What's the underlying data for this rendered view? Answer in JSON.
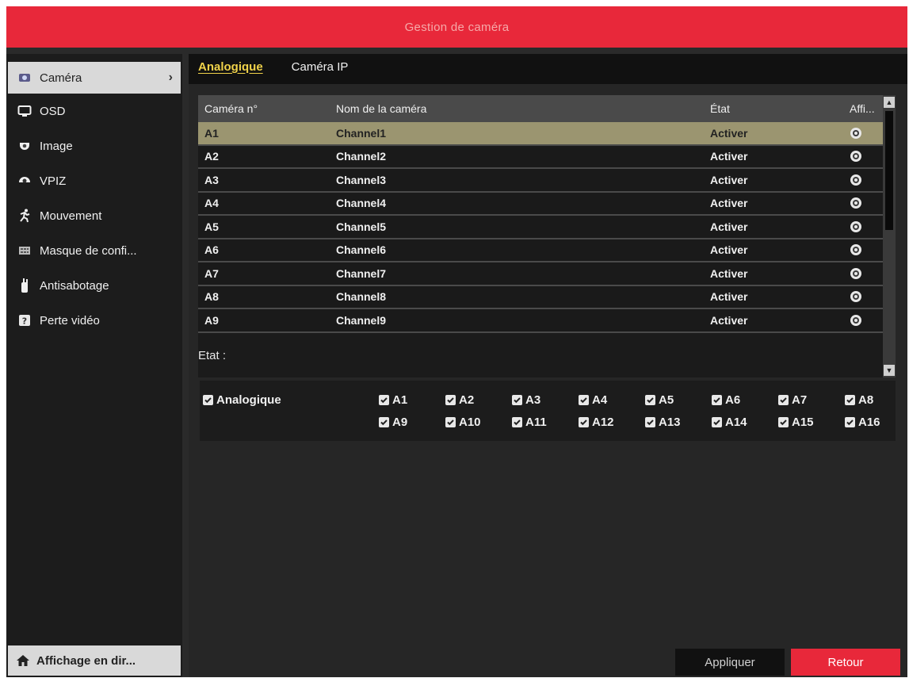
{
  "window": {
    "title": "Gestion de caméra"
  },
  "sidebar": {
    "items": [
      {
        "label": "Caméra",
        "icon": "camera-icon",
        "active": true
      },
      {
        "label": "OSD",
        "icon": "monitor-icon"
      },
      {
        "label": "Image",
        "icon": "camera-dome-icon"
      },
      {
        "label": "VPIZ",
        "icon": "ptz-icon"
      },
      {
        "label": "Mouvement",
        "icon": "running-man-icon"
      },
      {
        "label": "Masque de confi...",
        "icon": "privacy-mask-icon"
      },
      {
        "label": "Antisabotage",
        "icon": "tamper-icon"
      },
      {
        "label": "Perte vidéo",
        "icon": "question-icon"
      }
    ],
    "bottom": {
      "label": "Affichage en dir...",
      "icon": "home-icon"
    }
  },
  "tabs": [
    {
      "label": "Analogique",
      "active": true
    },
    {
      "label": "Caméra IP",
      "active": false
    }
  ],
  "table": {
    "headers": [
      "Caméra n°",
      "Nom de la caméra",
      "État",
      "Affi..."
    ],
    "rows": [
      {
        "num": "A1",
        "name": "Channel1",
        "state": "Activer"
      },
      {
        "num": "A2",
        "name": "Channel2",
        "state": "Activer"
      },
      {
        "num": "A3",
        "name": "Channel3",
        "state": "Activer"
      },
      {
        "num": "A4",
        "name": "Channel4",
        "state": "Activer"
      },
      {
        "num": "A5",
        "name": "Channel5",
        "state": "Activer"
      },
      {
        "num": "A6",
        "name": "Channel6",
        "state": "Activer"
      },
      {
        "num": "A7",
        "name": "Channel7",
        "state": "Activer"
      },
      {
        "num": "A8",
        "name": "Channel8",
        "state": "Activer"
      },
      {
        "num": "A9",
        "name": "Channel9",
        "state": "Activer"
      }
    ],
    "selected_row": 0
  },
  "status": {
    "label": "Etat :",
    "group_label": "Analogique",
    "channels": [
      "A1",
      "A2",
      "A3",
      "A4",
      "A5",
      "A6",
      "A7",
      "A8",
      "A9",
      "A10",
      "A11",
      "A12",
      "A13",
      "A14",
      "A15",
      "A16"
    ]
  },
  "buttons": {
    "apply": "Appliquer",
    "back": "Retour"
  },
  "colors": {
    "accent": "#e8283a",
    "tab_active": "#f0d24a",
    "selected_row": "#9b9570"
  }
}
